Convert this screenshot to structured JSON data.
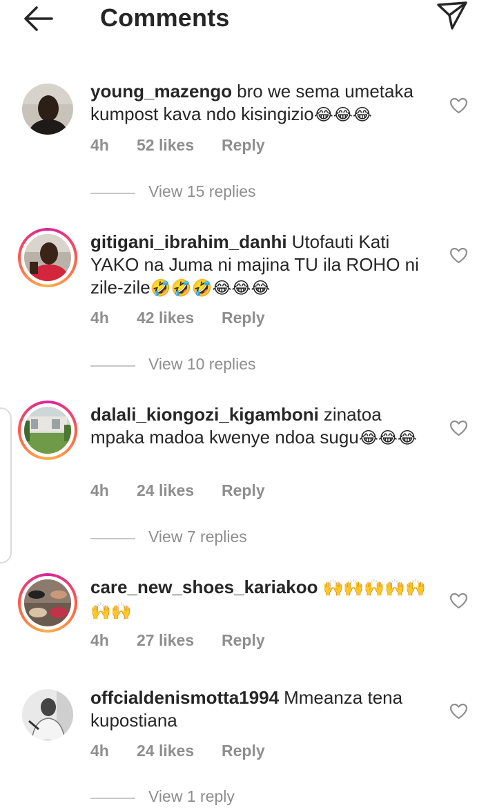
{
  "header": {
    "title": "Comments",
    "back_icon": "arrow-left-icon",
    "share_icon": "paper-plane-icon"
  },
  "comments": [
    {
      "username": "young_mazengo",
      "text": "bro we sema umetaka kumpost kava ndo kisingizio",
      "emojis": "😂😂😂",
      "time": "4h",
      "likes": "52 likes",
      "reply": "Reply",
      "view_replies": "View 15 replies"
    },
    {
      "username": "gitigani_ibrahim_danhi",
      "text": "Utofauti Kati YAKO na Juma ni majina TU ila ROHO ni zile-zile",
      "emojis": "🤣🤣🤣😂😂😂",
      "time": "4h",
      "likes": "42 likes",
      "reply": "Reply",
      "view_replies": "View 10 replies"
    },
    {
      "username": "dalali_kiongozi_kigamboni",
      "text": "zinatoa mpaka madoa kwenye ndoa sugu",
      "emojis": "😂😂😂",
      "time": "4h",
      "likes": "24 likes",
      "reply": "Reply",
      "view_replies": "View 7 replies"
    },
    {
      "username": "care_new_shoes_kariakoo",
      "text": "",
      "emojis": "🙌🙌🙌🙌🙌🙌🙌",
      "time": "4h",
      "likes": "27 likes",
      "reply": "Reply"
    },
    {
      "username": "offcialdenismotta1994",
      "text": "Mmeanza tena kupostiana",
      "emojis": "",
      "time": "4h",
      "likes": "24 likes",
      "reply": "Reply",
      "view_replies": "View 1 reply"
    }
  ],
  "colors": {
    "text": "#262626",
    "muted": "#8e8e8e",
    "divider": "#c7c7c7",
    "story_ring": [
      "#d6249f",
      "#fd5949",
      "#fdb34a"
    ]
  }
}
